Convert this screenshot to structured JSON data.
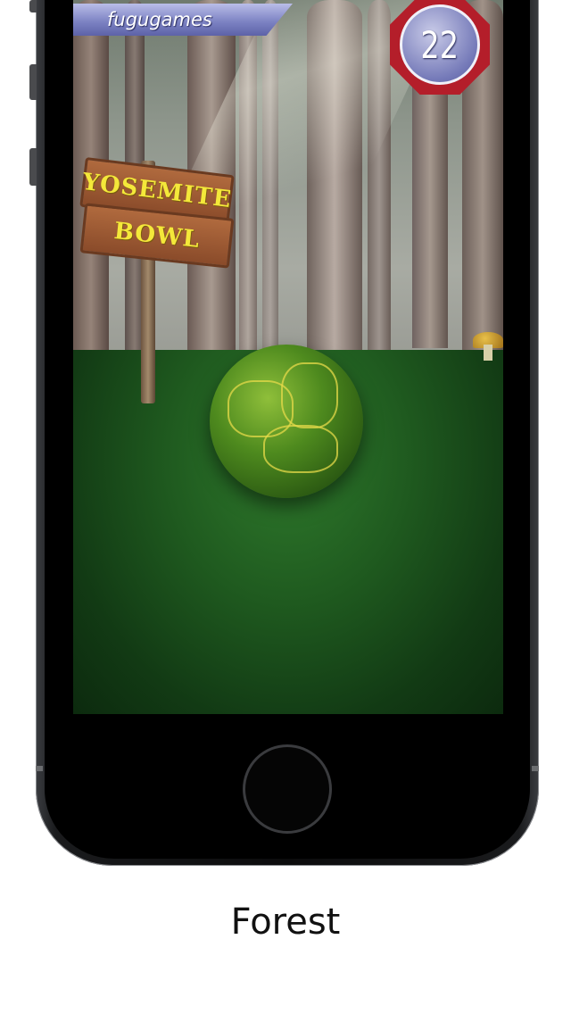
{
  "hud": {
    "player_name": "fugugames",
    "score": "22"
  },
  "scene": {
    "sign_line1": "YOSEMITE",
    "sign_line2": "BOWL"
  },
  "caption": {
    "title": "Forest"
  },
  "colors": {
    "banner": "#7e84c4",
    "score_ring": "#b41e2a",
    "ground": "#1f5a1f",
    "ball": "#4e8a1e",
    "sign_text": "#f4e83a"
  }
}
